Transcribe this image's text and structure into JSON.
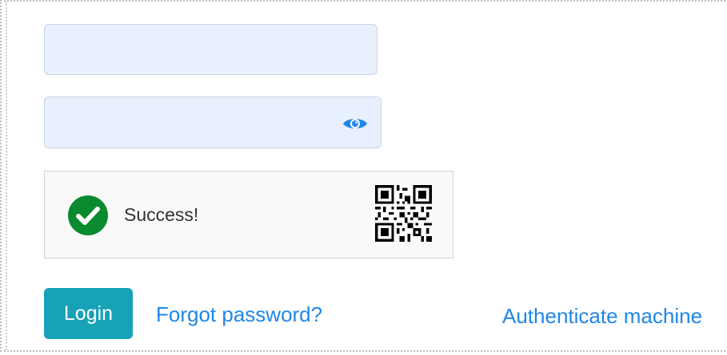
{
  "form": {
    "username": {
      "value": "",
      "placeholder": ""
    },
    "password": {
      "value": "",
      "placeholder": "",
      "toggle_icon": "eye-icon"
    },
    "captcha": {
      "status_text": "Success!",
      "status_icon": "checkmark-circle-icon",
      "logo_icon": "qr-code-icon"
    },
    "login_label": "Login",
    "forgot_label": "Forgot password?",
    "authenticate_label": "Authenticate machine"
  },
  "colors": {
    "input_bg": "#e8f0fe",
    "accent_button": "#17a2b8",
    "link": "#1f87e8",
    "success": "#0a8a2e",
    "eye": "#1f87e8"
  }
}
